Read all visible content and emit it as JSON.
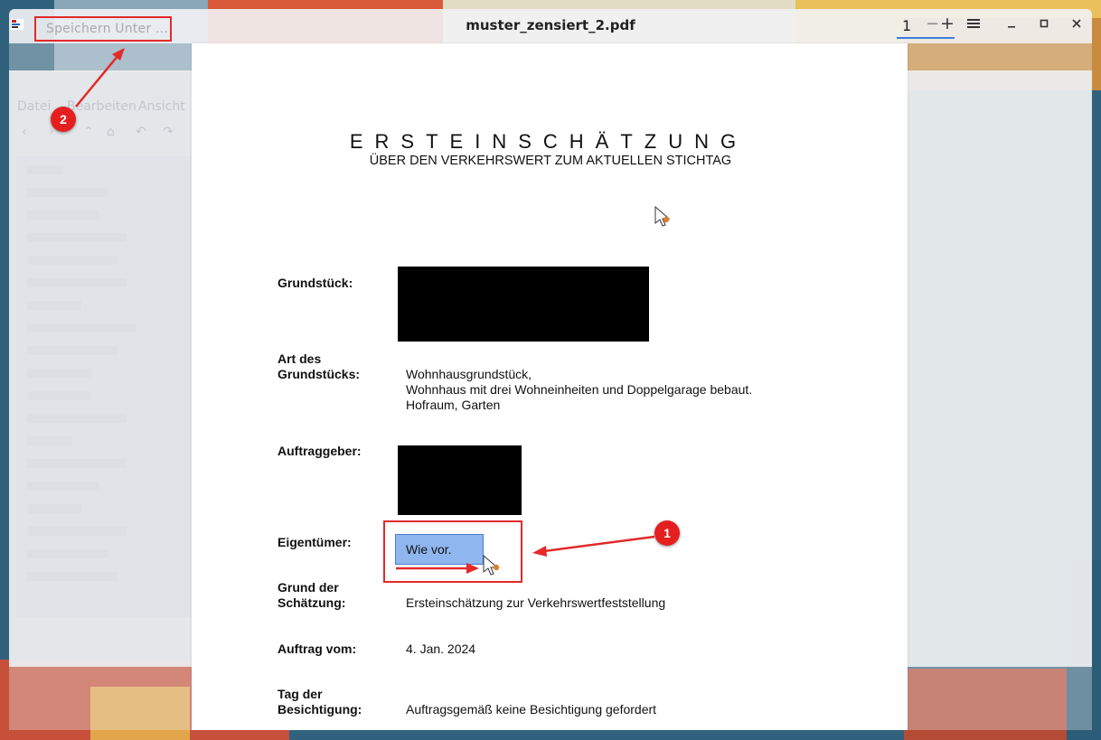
{
  "window": {
    "title": "muster_zensiert_2.pdf",
    "save_as_label": "Speichern Unter …",
    "page_number": "1",
    "page_decrement": "−",
    "page_increment": "+",
    "menu_icon": "hamburger-menu-icon",
    "minimize_icon": "minimize-icon",
    "maximize_icon": "maximize-icon",
    "close_icon": "close-icon"
  },
  "background_window": {
    "menu": [
      "Datei",
      "Bearbeiten",
      "Ansicht"
    ],
    "nav_icons": [
      "back-arrow-icon",
      "forward-arrow-icon",
      "up-arrow-icon",
      "home-icon",
      "undo-icon",
      "redo-icon"
    ]
  },
  "document": {
    "title": "ERSTEINSCHÄTZUNG",
    "subtitle": "ÜBER DEN VERKEHRSWERT ZUM AKTUELLEN STICHTAG",
    "fields": {
      "grundstueck": {
        "label": "Grundstück:"
      },
      "art": {
        "label_line1": "Art des",
        "label_line2": "Grundstücks:",
        "value_line1": "Wohnhausgrundstück,",
        "value_line2": "Wohnhaus mit drei Wohneinheiten und Doppelgarage bebaut.",
        "value_line3": "Hofraum, Garten"
      },
      "auftraggeber": {
        "label": "Auftraggeber:"
      },
      "eigentuemer": {
        "label": "Eigentümer:",
        "value": "Wie vor."
      },
      "grund": {
        "label_line1": "Grund der",
        "label_line2": "Schätzung:",
        "value": "Ersteinschätzung zur Verkehrswertfeststellung"
      },
      "auftrag": {
        "label": "Auftrag vom:",
        "value": "4. Jan. 2024"
      },
      "besichtigung": {
        "label_line1": "Tag der",
        "label_line2": "Besichtigung:",
        "value": "Auftragsgemäß keine Besichtigung gefordert"
      }
    }
  },
  "annotations": {
    "badge_1": "1",
    "badge_2": "2",
    "colors": {
      "annotation_red": "#e22a2a",
      "highlight_blue": "#8fb6ee",
      "cursor_dot": "#d9822b"
    }
  }
}
